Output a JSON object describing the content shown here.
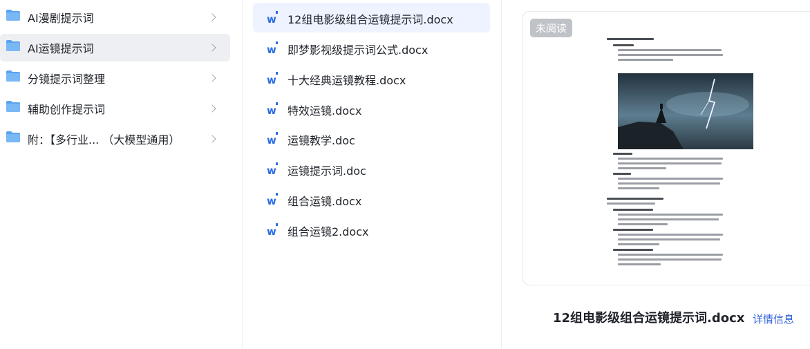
{
  "folders": [
    {
      "label": "AI漫剧提示词",
      "selected": false
    },
    {
      "label": "AI运镜提示词",
      "selected": true
    },
    {
      "label": "分镜提示词整理",
      "selected": false
    },
    {
      "label": "辅助创作提示词",
      "selected": false
    },
    {
      "label": "附：【多行业... （大模型通用）",
      "selected": false
    }
  ],
  "files": [
    {
      "label": "12组电影级组合运镜提示词.docx",
      "selected": true
    },
    {
      "label": "即梦影视级提示词公式.docx",
      "selected": false
    },
    {
      "label": "十大经典运镜教程.docx",
      "selected": false
    },
    {
      "label": "特效运镜.docx",
      "selected": false
    },
    {
      "label": "运镜教学.doc",
      "selected": false
    },
    {
      "label": "运镜提示词.doc",
      "selected": false
    },
    {
      "label": "组合运镜.docx",
      "selected": false
    },
    {
      "label": "组合运镜2.docx",
      "selected": false
    }
  ],
  "preview": {
    "badge": "未阅读",
    "title": "12组电影级组合运镜提示词.docx",
    "detail_link": "详情信息"
  },
  "colors": {
    "folder": "#5aa3f0",
    "word": "#2b6ce4",
    "link": "#2e5fd8",
    "selected_folder_bg": "#eeeff2",
    "selected_file_bg": "#eef3ff"
  }
}
